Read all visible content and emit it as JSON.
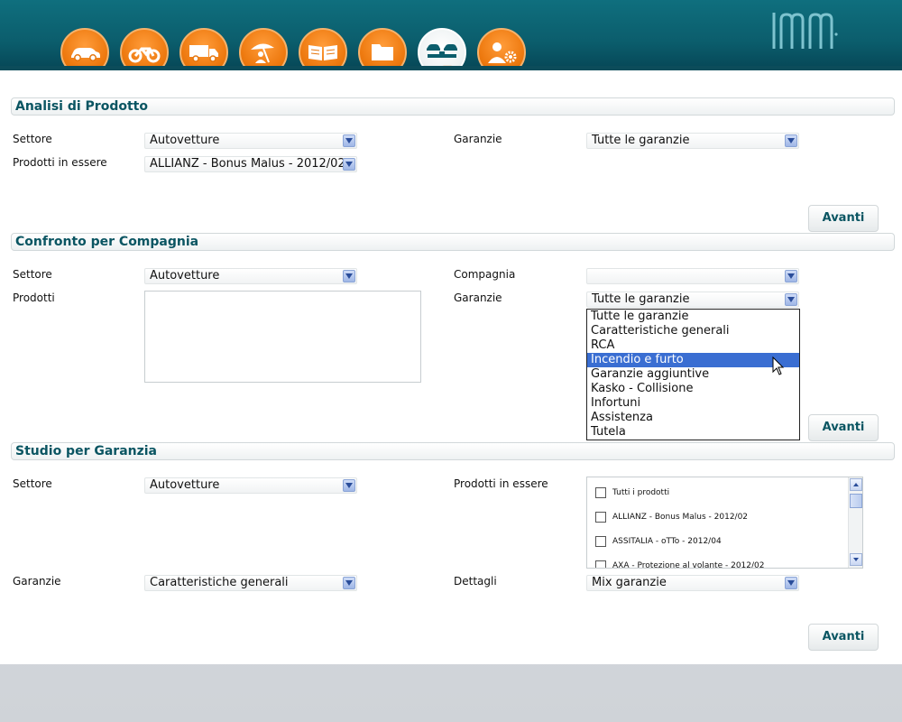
{
  "nav": {
    "items": [
      {
        "icon": "car-icon"
      },
      {
        "icon": "motorcycle-icon"
      },
      {
        "icon": "truck-icon"
      },
      {
        "icon": "umbrella-person-icon"
      },
      {
        "icon": "open-book-icon"
      },
      {
        "icon": "folder-icon"
      },
      {
        "icon": "car-comparison-icon",
        "active": true
      },
      {
        "icon": "user-gear-icon"
      }
    ]
  },
  "section1": {
    "title": "Analisi di Prodotto",
    "settore_label": "Settore",
    "settore_value": "Autovetture",
    "prodotti_label": "Prodotti in essere",
    "prodotti_value": "ALLIANZ - Bonus Malus - 2012/02",
    "garanzie_label": "Garanzie",
    "garanzie_value": "Tutte le garanzie",
    "button": "Avanti"
  },
  "section2": {
    "title": "Confronto per Compagnia",
    "settore_label": "Settore",
    "settore_value": "Autovetture",
    "prodotti_label": "Prodotti",
    "compagnia_label": "Compagnia",
    "compagnia_value": "",
    "garanzie_label": "Garanzie",
    "garanzie_value": "Tutte le garanzie",
    "dropdown_options": [
      "Tutte le garanzie",
      "Caratteristiche generali",
      "RCA",
      "Incendio e furto",
      "Garanzie aggiuntive",
      "Kasko - Collisione",
      "Infortuni",
      "Assistenza",
      "Tutela"
    ],
    "highlighted_option": "Incendio e furto",
    "button": "Avanti"
  },
  "section3": {
    "title": "Studio per Garanzia",
    "settore_label": "Settore",
    "settore_value": "Autovetture",
    "garanzie_label": "Garanzie",
    "garanzie_value": "Caratteristiche generali",
    "prodotti_label": "Prodotti in essere",
    "prodotti_items": [
      "Tutti i prodotti",
      "ALLIANZ - Bonus Malus - 2012/02",
      "ASSITALIA - oTTo - 2012/04",
      "AXA - Protezione al volante - 2012/02"
    ],
    "dettagli_label": "Dettagli",
    "dettagli_value": "Mix garanzie",
    "button": "Avanti"
  },
  "colors": {
    "header": "#0b5d6c",
    "accent_orange": "#ee7a10",
    "title_teal": "#0a5562",
    "highlight": "#3a6ed2"
  }
}
